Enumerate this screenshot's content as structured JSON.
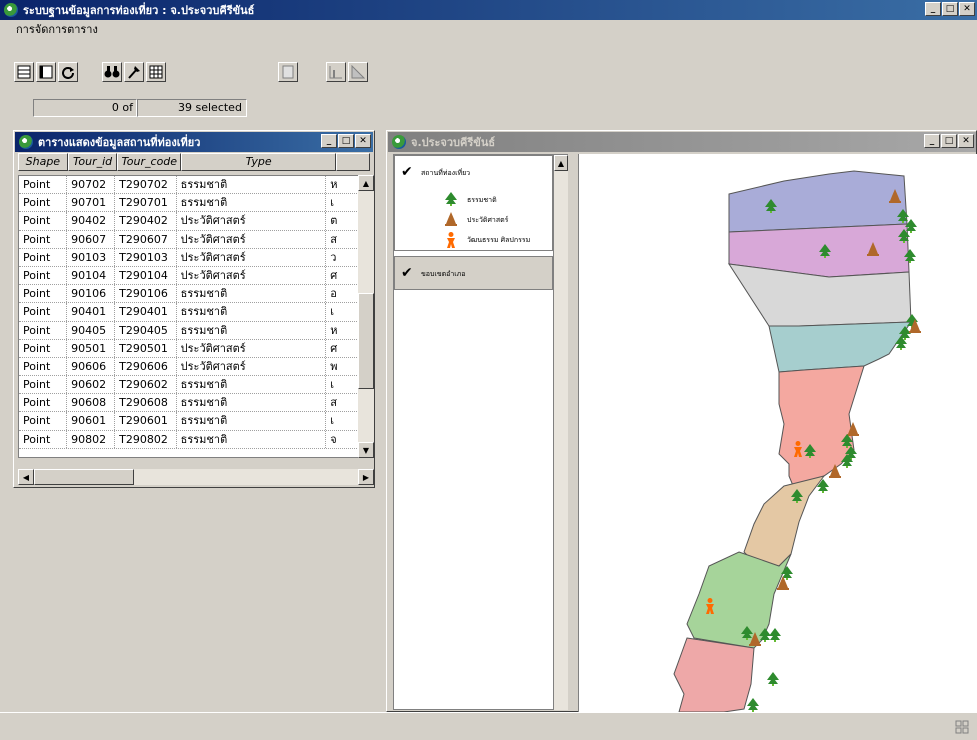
{
  "app": {
    "title": "ระบบฐานข้อมูลการท่องเที่ยว : จ.ประจวบคีรีขันธ์"
  },
  "menu": {
    "items": [
      "การจัดการตาราง"
    ]
  },
  "selection": {
    "count": "0",
    "of_label": "of",
    "total": "39",
    "selected_label": "selected"
  },
  "table_window": {
    "title": "ตารางแสดงข้อมูลสถานที่ท่องเที่ยว",
    "columns": [
      "Shape",
      "Tour_id",
      "Tour_code",
      "Type"
    ],
    "rows": [
      [
        "Point",
        "90702",
        "T290702",
        "ธรรมชาติ",
        "ห"
      ],
      [
        "Point",
        "90701",
        "T290701",
        "ธรรมชาติ",
        "เ"
      ],
      [
        "Point",
        "90402",
        "T290402",
        "ประวัติศาสตร์",
        "ต"
      ],
      [
        "Point",
        "90607",
        "T290607",
        "ประวัติศาสตร์",
        "ส"
      ],
      [
        "Point",
        "90103",
        "T290103",
        "ประวัติศาสตร์",
        "ว"
      ],
      [
        "Point",
        "90104",
        "T290104",
        "ประวัติศาสตร์",
        "ศ"
      ],
      [
        "Point",
        "90106",
        "T290106",
        "ธรรมชาติ",
        "อ"
      ],
      [
        "Point",
        "90401",
        "T290401",
        "ธรรมชาติ",
        "เ"
      ],
      [
        "Point",
        "90405",
        "T290405",
        "ธรรมชาติ",
        "ห"
      ],
      [
        "Point",
        "90501",
        "T290501",
        "ประวัติศาสตร์",
        "ศ"
      ],
      [
        "Point",
        "90606",
        "T290606",
        "ประวัติศาสตร์",
        "พ"
      ],
      [
        "Point",
        "90602",
        "T290602",
        "ธรรมชาติ",
        "เ"
      ],
      [
        "Point",
        "90608",
        "T290608",
        "ธรรมชาติ",
        "ส"
      ],
      [
        "Point",
        "90601",
        "T290601",
        "ธรรมชาติ",
        "เ"
      ],
      [
        "Point",
        "90802",
        "T290802",
        "ธรรมชาติ",
        "จ"
      ]
    ]
  },
  "map_window": {
    "title": "จ.ประจวบคีรีขันธ์",
    "legend": {
      "layer1": "สถานที่ท่องเที่ยว",
      "items": [
        "ธรรมชาติ",
        "ประวัติศาสตร์",
        "วัฒนธรรม ศิลปกรรม"
      ],
      "layer2": "ขอบเขตอำเภอ"
    }
  },
  "colors": {
    "title_active": "#0a246a",
    "nature": "#2e8b2e",
    "history": "#b0682a",
    "culture": "#ff6a00",
    "districts": [
      "#a9acd8",
      "#d8a8d8",
      "#d8d8d8",
      "#a6cece",
      "#f4a8a0",
      "#e4c8a4",
      "#a6d49a",
      "#eea8a8"
    ]
  },
  "icons": [
    "map-globe-icon",
    "table-icon",
    "binoculars-icon",
    "tool-icon"
  ]
}
